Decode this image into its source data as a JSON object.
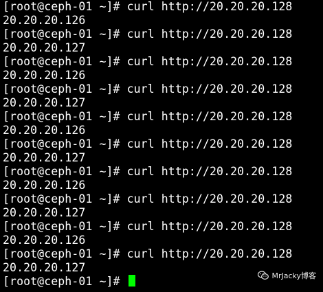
{
  "terminal": {
    "lines": [
      "[root@ceph-01 ~]# curl http://20.20.20.128",
      "20.20.20.126",
      "[root@ceph-01 ~]# curl http://20.20.20.128",
      "20.20.20.127",
      "[root@ceph-01 ~]# curl http://20.20.20.128",
      "20.20.20.126",
      "[root@ceph-01 ~]# curl http://20.20.20.128",
      "20.20.20.127",
      "[root@ceph-01 ~]# curl http://20.20.20.128",
      "20.20.20.126",
      "[root@ceph-01 ~]# curl http://20.20.20.128",
      "20.20.20.127",
      "[root@ceph-01 ~]# curl http://20.20.20.128",
      "20.20.20.126",
      "[root@ceph-01 ~]# curl http://20.20.20.128",
      "20.20.20.127",
      "[root@ceph-01 ~]# curl http://20.20.20.128",
      "20.20.20.126",
      "[root@ceph-01 ~]# curl http://20.20.20.128",
      "20.20.20.127"
    ],
    "prompt": "[root@ceph-01 ~]# ",
    "cursor_color": "#00ff00",
    "background_color": "#000000",
    "text_color": "#ffffff"
  },
  "watermark": {
    "text": "MrJacky博客",
    "icon": "wechat-icon"
  }
}
